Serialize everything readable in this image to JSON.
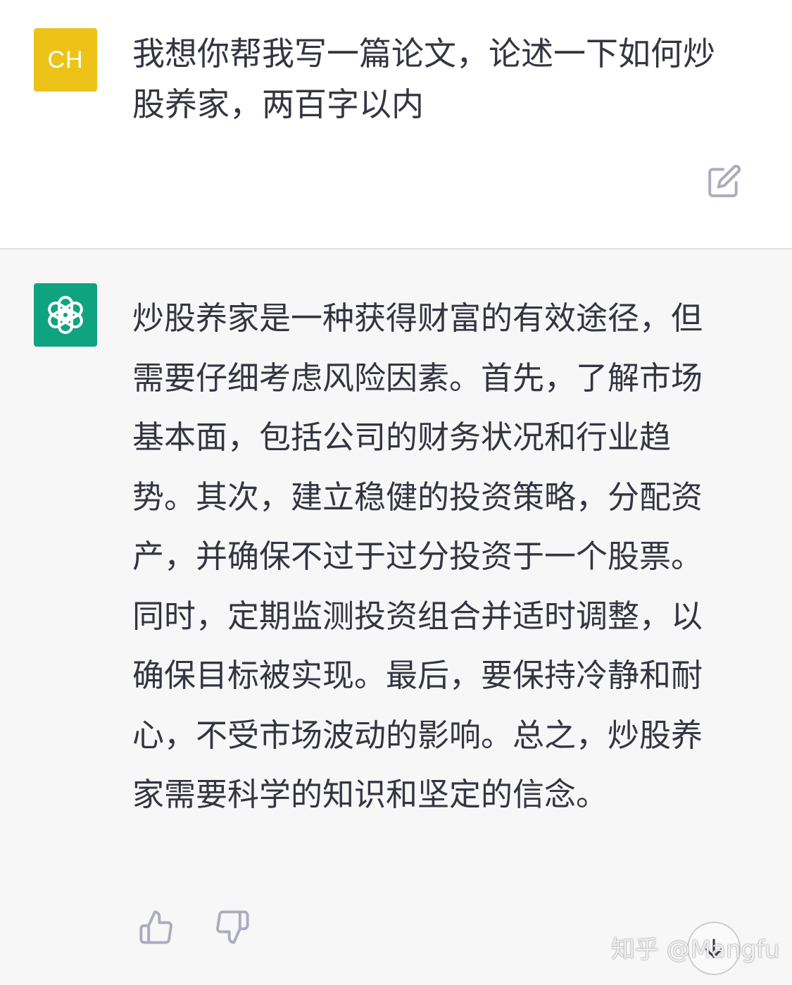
{
  "user_message": {
    "avatar_initials": "CH",
    "text": "我想你帮我写一篇论文，论述一下如何炒股养家，两百字以内"
  },
  "assistant_message": {
    "text": "炒股养家是一种获得财富的有效途径，但需要仔细考虑风险因素。首先，了解市场基本面，包括公司的财务状况和行业趋势。其次，建立稳健的投资策略，分配资产，并确保不过于过分投资于一个股票。同时，定期监测投资组合并适时调整，以确保目标被实现。最后，要保持冷静和耐心，不受市场波动的影响。总之，炒股养家需要科学的知识和坚定的信念。"
  },
  "watermark": "知乎 @Mangfu",
  "icons": {
    "edit": "edit-icon",
    "assistant_avatar": "openai-logo-icon",
    "like": "thumbs-up-icon",
    "dislike": "thumbs-down-icon",
    "scroll": "arrow-down-icon"
  },
  "colors": {
    "user_avatar": "#edc31a",
    "assistant_avatar": "#10a37f",
    "assistant_background": "#f7f7f8",
    "text": "#343541",
    "icon_gray": "#acacbe"
  }
}
